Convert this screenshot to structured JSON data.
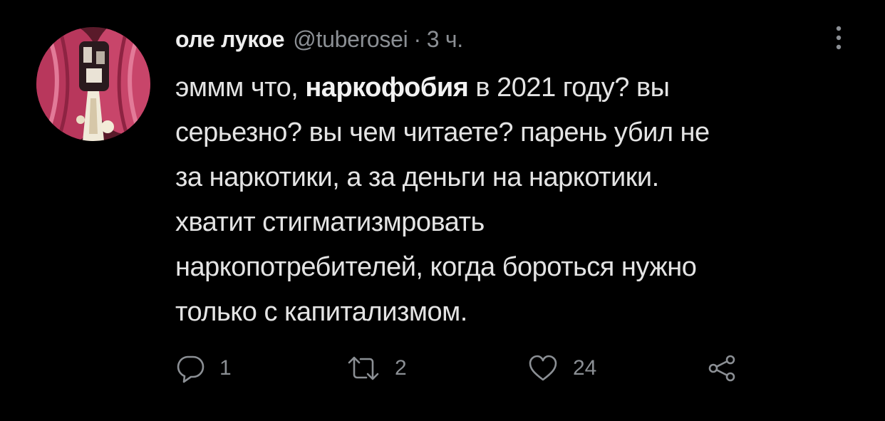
{
  "tweet": {
    "author_name": "оле лукое",
    "handle": "@tuberosei",
    "separator": "·",
    "time": "3 ч.",
    "text_before_bold": "эммм что, ",
    "text_bold": "наркофобия",
    "text_after_bold": " в 2021 году? вы",
    "lines": [
      "серьезно? вы чем читаете? парень убил не",
      "за наркотики, а за деньги на наркотики.",
      "хватит стигматизмровать",
      "наркопотребителей, когда бороться нужно",
      "только с капитализмом."
    ]
  },
  "actions": {
    "reply_count": "1",
    "retweet_count": "2",
    "like_count": "24"
  },
  "icons": {
    "more": "vertical-dots-icon",
    "reply": "speech-bubble-icon",
    "retweet": "retweet-arrows-icon",
    "like": "heart-icon",
    "share": "share-nodes-icon"
  },
  "colors": {
    "background": "#000000",
    "text": "#e4e4e4",
    "muted": "#8b8f94",
    "avatar_accent": "#c8456a"
  }
}
